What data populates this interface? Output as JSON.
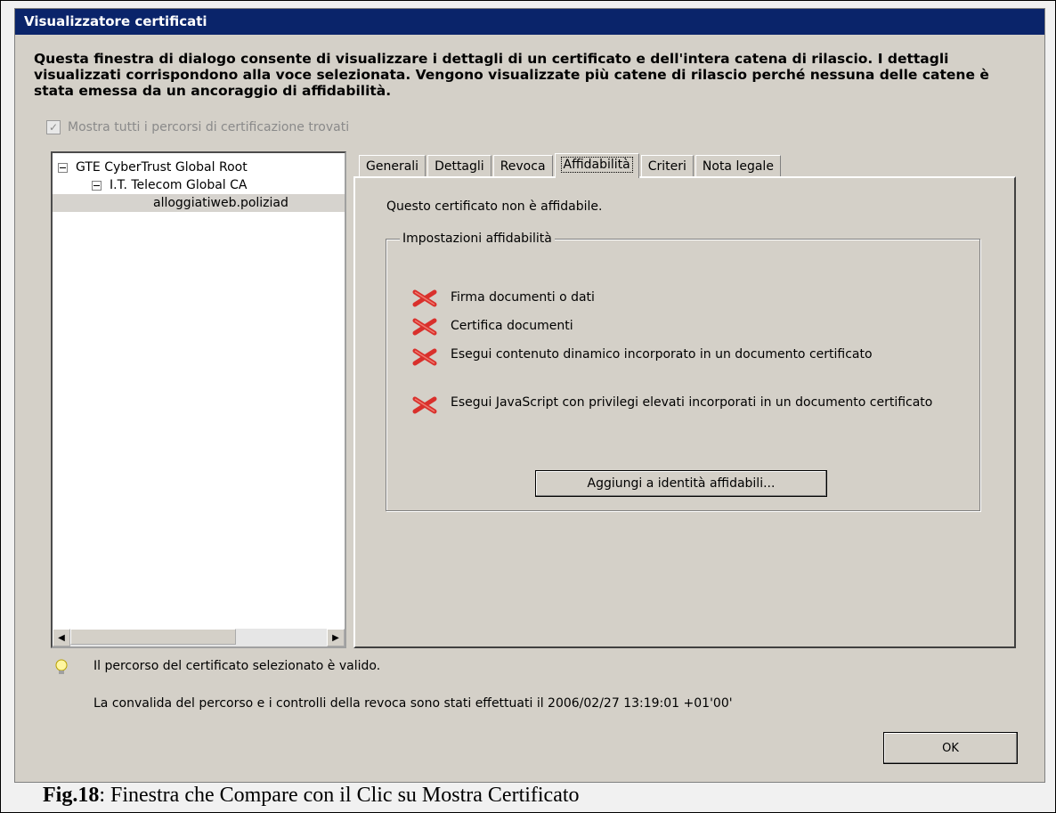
{
  "window": {
    "title": "Visualizzatore certificati"
  },
  "intro": "Questa finestra di dialogo consente di visualizzare i dettagli di un certificato e dell'intera catena di rilascio. I dettagli visualizzati corrispondono alla voce selezionata. Vengono visualizzate più catene di rilascio perché nessuna delle catene è stata emessa da un ancoraggio di affidabilità.",
  "show_all": {
    "label": "Mostra tutti i percorsi di certificazione trovati",
    "checked": true
  },
  "tree": {
    "items": [
      {
        "label": "GTE CyberTrust Global Root",
        "level": 0
      },
      {
        "label": "I.T. Telecom Global CA",
        "level": 1
      },
      {
        "label": "alloggiatiweb.poliziad",
        "level": 2,
        "selected": true
      }
    ]
  },
  "tabs": [
    {
      "label": "Generali"
    },
    {
      "label": "Dettagli"
    },
    {
      "label": "Revoca"
    },
    {
      "label": "Affidabilità",
      "active": true
    },
    {
      "label": "Criteri"
    },
    {
      "label": "Nota legale"
    }
  ],
  "trust": {
    "status_text": "Questo certificato non è affidabile.",
    "group_label": "Impostazioni affidabilità",
    "items": [
      {
        "label": "Firma documenti o dati",
        "icon": "red-x-icon"
      },
      {
        "label": "Certifica documenti",
        "icon": "red-x-icon"
      },
      {
        "label": "Esegui contenuto dinamico incorporato in un documento certificato",
        "icon": "red-x-icon"
      },
      {
        "label": "Esegui JavaScript con privilegi elevati incorporati in un documento certificato",
        "icon": "red-x-icon"
      }
    ],
    "add_button": "Aggiungi a identità affidabili..."
  },
  "status": {
    "valid_text": "Il percorso del certificato selezionato è valido.",
    "check_text": "La convalida del percorso e i controlli della revoca sono stati effettuati il 2006/02/27 13:19:01 +01'00'"
  },
  "ok_button": "OK",
  "caption": {
    "prefix": "Fig.18",
    "text": ": Finestra che Compare con il Clic su Mostra Certificato"
  },
  "colors": {
    "titlebar": "#0a246a",
    "dialog": "#d4d0c8",
    "x_icon": "#d9302c"
  }
}
